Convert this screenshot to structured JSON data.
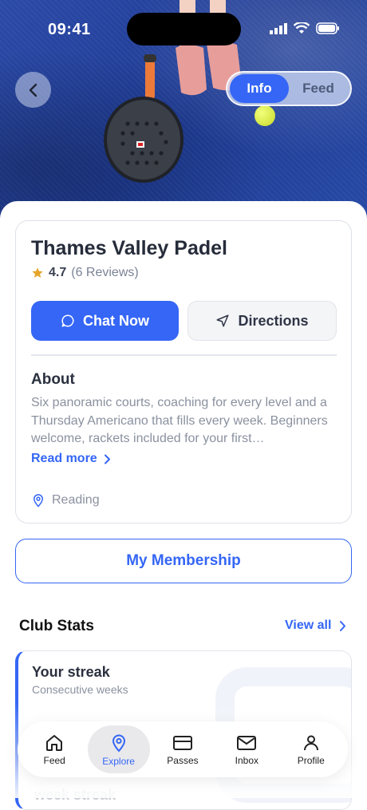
{
  "status_bar": {
    "time": "09:41"
  },
  "hero": {
    "back_icon": "chevron-left-icon"
  },
  "segmented": {
    "tabs": [
      {
        "label": "Info",
        "active": true
      },
      {
        "label": "Feed",
        "active": false
      }
    ]
  },
  "club": {
    "name": "Thames Valley Padel",
    "rating": "4.7",
    "reviews": "(6 Reviews)",
    "chat_label": "Chat Now",
    "directions_label": "Directions",
    "about_heading": "About",
    "about_text": "Six panoramic courts, coaching for every level and a Thursday Americano that fills every week. Beginners welcome, rackets included for your first…",
    "read_more": "Read more",
    "location": "Reading"
  },
  "membership_label": "My Membership",
  "stats": {
    "heading": "Club Stats",
    "view_all": "View all",
    "card_title": "Your streak",
    "card_sub": "Consecutive weeks",
    "peek_text": "week streak"
  },
  "nav": {
    "items": [
      {
        "label": "Feed",
        "icon": "home-icon"
      },
      {
        "label": "Explore",
        "icon": "location-pin-icon",
        "active": true
      },
      {
        "label": "Passes",
        "icon": "card-icon"
      },
      {
        "label": "Inbox",
        "icon": "mail-icon"
      },
      {
        "label": "Profile",
        "icon": "person-icon"
      }
    ]
  },
  "colors": {
    "accent": "#3566f5",
    "star": "#e5a52a"
  }
}
